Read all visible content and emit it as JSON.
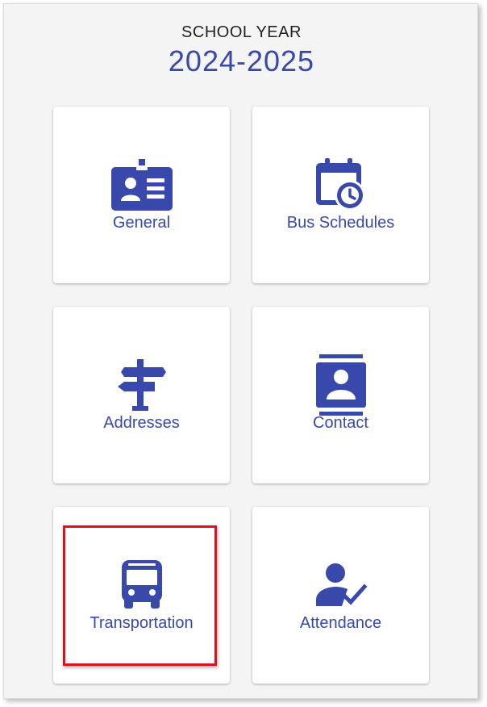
{
  "header": {
    "label": "SCHOOL YEAR",
    "year": "2024-2025"
  },
  "tiles": [
    {
      "label": "General",
      "icon": "id-badge-icon"
    },
    {
      "label": "Bus Schedules",
      "icon": "calendar-clock-icon"
    },
    {
      "label": "Addresses",
      "icon": "signpost-icon"
    },
    {
      "label": "Contact",
      "icon": "contact-card-icon"
    },
    {
      "label": "Transportation",
      "icon": "bus-icon"
    },
    {
      "label": "Attendance",
      "icon": "person-check-icon"
    }
  ],
  "highlighted_tile": "Transportation",
  "colors": {
    "accent": "#3949ab",
    "background": "#f4f4f4",
    "tile": "#ffffff",
    "highlight": "#d9141c"
  }
}
